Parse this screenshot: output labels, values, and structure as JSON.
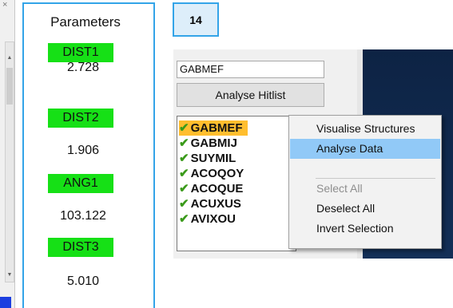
{
  "parameters": {
    "title": "Parameters",
    "items": [
      {
        "label": "DIST1",
        "value": "2.728"
      },
      {
        "label": "DIST2",
        "value": "1.906"
      },
      {
        "label": "ANG1",
        "value": "103.122"
      },
      {
        "label": "DIST3",
        "value": "5.010"
      }
    ]
  },
  "badge": {
    "number": "14"
  },
  "hitlist_panel": {
    "input_value": "GABMEF",
    "analyse_button": "Analyse Hitlist",
    "items": [
      "GABMEF",
      "GABMIJ",
      "SUYMIL",
      "ACOQOY",
      "ACOQUE",
      "ACUXUS",
      "AVIXOU"
    ],
    "selected_index": 0
  },
  "context_menu": {
    "items": [
      {
        "label": "Visualise Structures",
        "state": "normal"
      },
      {
        "label": "Analyse Data",
        "state": "highlighted"
      },
      {
        "label": "Select All",
        "state": "disabled"
      },
      {
        "label": "Deselect All",
        "state": "normal"
      },
      {
        "label": "Invert Selection",
        "state": "normal"
      }
    ]
  },
  "left_strip": {
    "close_glyph": "×"
  },
  "colors": {
    "param_label_bg": "#16e016",
    "panel_border": "#33a4e8",
    "menu_highlight": "#91c9f7",
    "selected_item_bg": "#ffbe2e",
    "check_color": "#3a9a1a"
  },
  "icons": {
    "check": "check-icon",
    "close": "close-icon"
  }
}
